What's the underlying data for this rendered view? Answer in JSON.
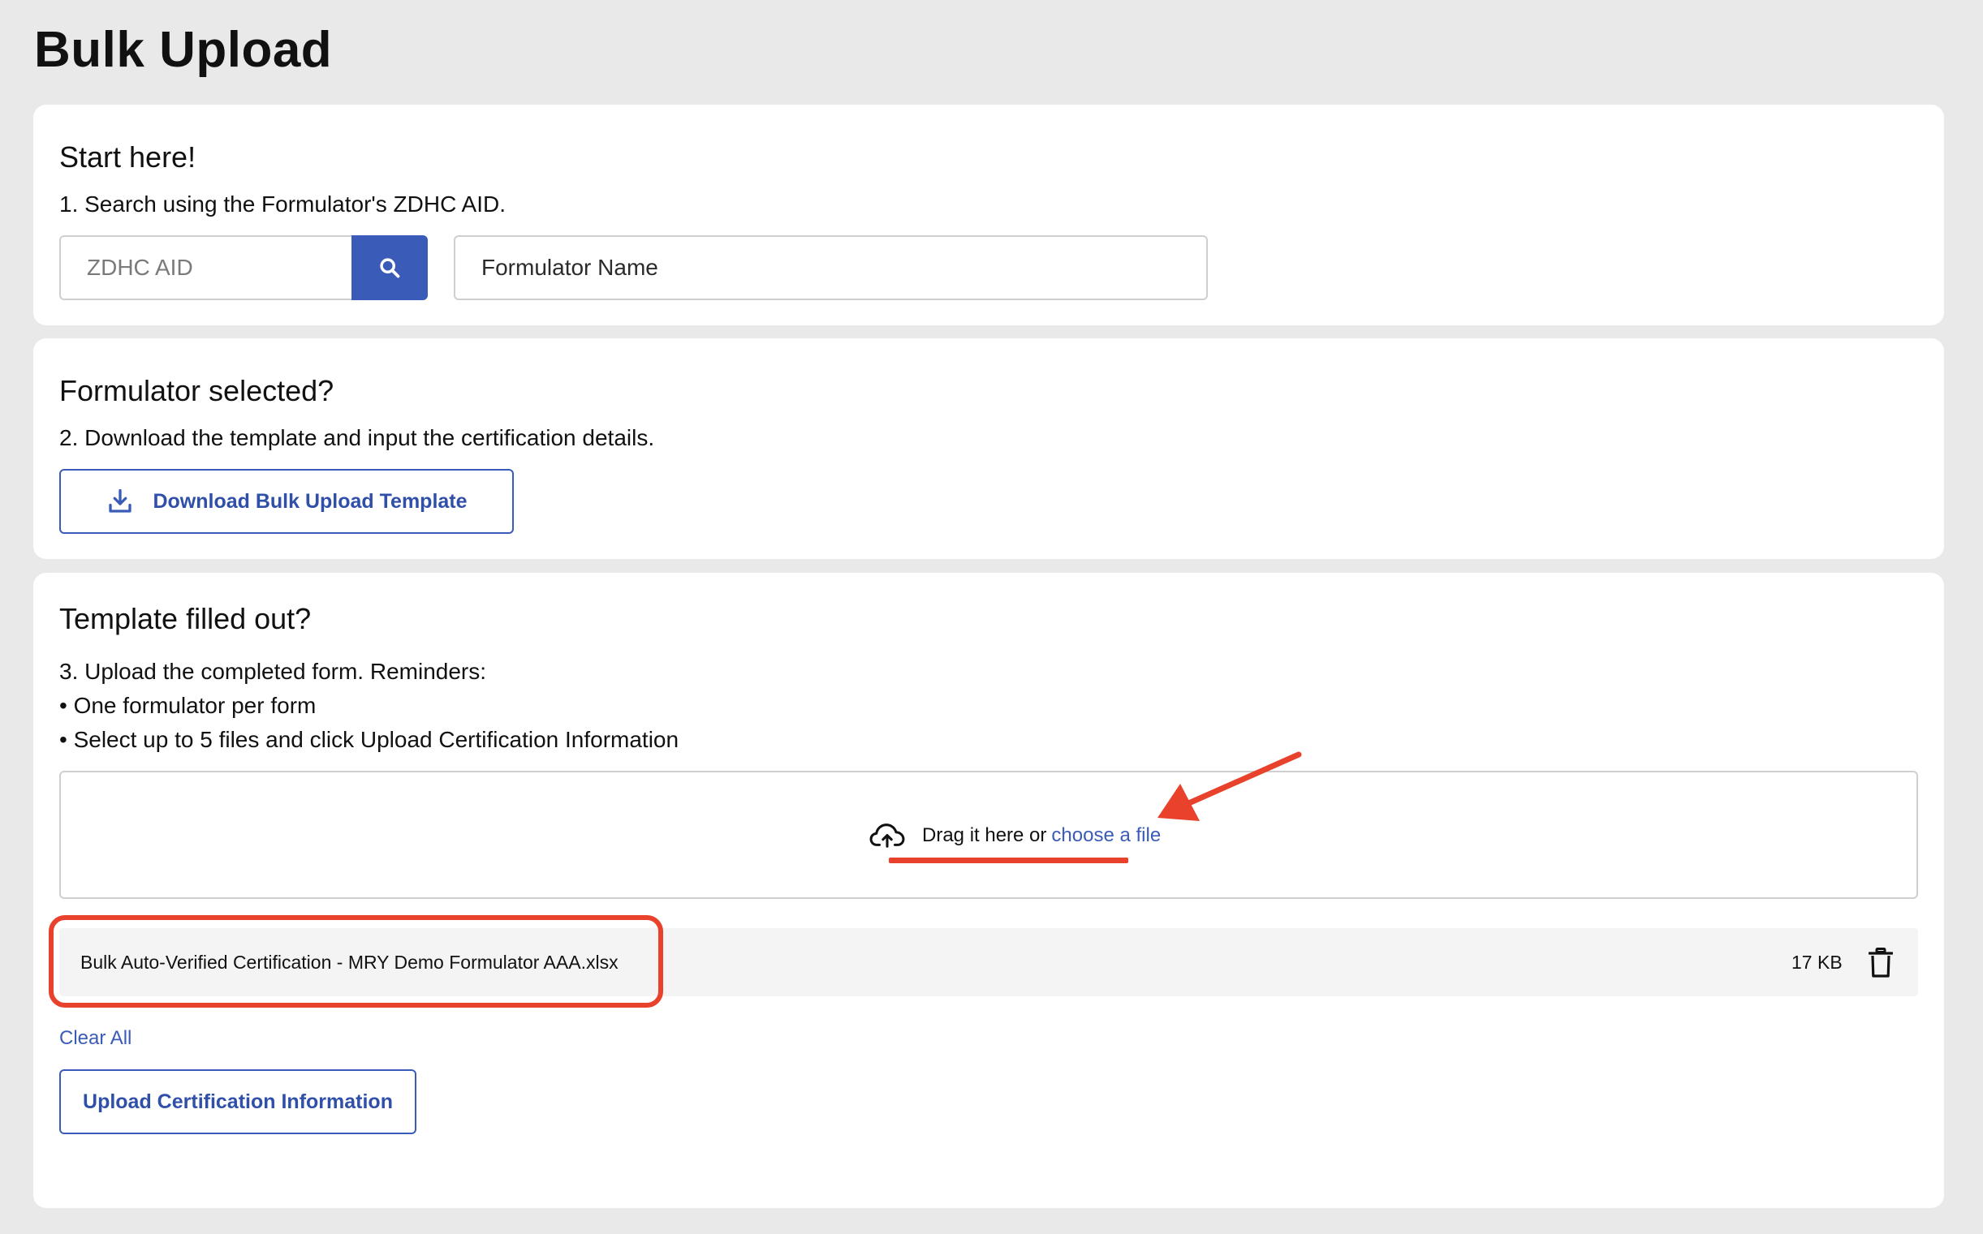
{
  "page": {
    "title": "Bulk Upload"
  },
  "start": {
    "heading": "Start here!",
    "step_text": "1. Search using the Formulator's ZDHC AID.",
    "aid_placeholder": "ZDHC AID",
    "name_placeholder": "Formulator Name",
    "search_icon": "search-icon"
  },
  "formulator": {
    "heading": "Formulator selected?",
    "step_text": "2. Download the template and input the certification details.",
    "download_label": "Download Bulk Upload Template",
    "download_icon": "download-icon"
  },
  "template": {
    "heading": "Template filled out?",
    "step_text": "3. Upload the completed form. Reminders:",
    "reminders": [
      "• One formulator per form",
      "• Select up to 5 files and click Upload Certification Information"
    ],
    "dropzone": {
      "icon": "cloud-upload-icon",
      "text": "Drag it here or",
      "link": "choose a file"
    },
    "files": [
      {
        "name": "Bulk Auto-Verified Certification - MRY Demo Formulator AAA.xlsx",
        "size": "17 KB"
      }
    ],
    "clear_all": "Clear All",
    "upload_label": "Upload Certification Information"
  },
  "colors": {
    "accent": "#3a5bb8",
    "annotation": "#e8412c",
    "background": "#e9e9e9"
  }
}
